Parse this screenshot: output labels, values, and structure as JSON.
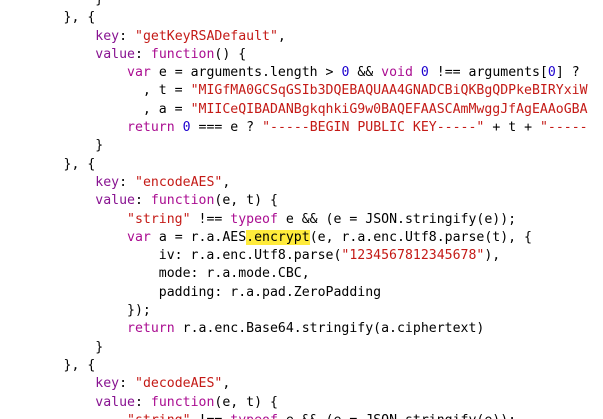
{
  "colors": {
    "background": "#ffffff",
    "text": "#000000",
    "property_key": "#881391",
    "string": "#c41a16",
    "keyword": "#aa0d91",
    "number": "#1c00cf",
    "highlight": "#ffeb3b"
  },
  "code": {
    "lines": [
      {
        "indent": "            ",
        "tokens": [
          {
            "t": "}",
            "k": "plain"
          }
        ]
      },
      {
        "indent": "        ",
        "tokens": [
          {
            "t": "}, {",
            "k": "plain"
          }
        ]
      },
      {
        "indent": "            ",
        "tokens": [
          {
            "t": "key",
            "k": "key"
          },
          {
            "t": ": ",
            "k": "plain"
          },
          {
            "t": "\"getKeyRSADefault\"",
            "k": "str"
          },
          {
            "t": ",",
            "k": "plain"
          }
        ]
      },
      {
        "indent": "            ",
        "tokens": [
          {
            "t": "value",
            "k": "key"
          },
          {
            "t": ": ",
            "k": "plain"
          },
          {
            "t": "function",
            "k": "kw"
          },
          {
            "t": "() {",
            "k": "plain"
          }
        ]
      },
      {
        "indent": "                ",
        "tokens": [
          {
            "t": "var",
            "k": "kw"
          },
          {
            "t": " e = arguments.length > ",
            "k": "plain"
          },
          {
            "t": "0",
            "k": "num"
          },
          {
            "t": " && ",
            "k": "plain"
          },
          {
            "t": "void",
            "k": "kw"
          },
          {
            "t": " ",
            "k": "plain"
          },
          {
            "t": "0",
            "k": "num"
          },
          {
            "t": " !== arguments[",
            "k": "plain"
          },
          {
            "t": "0",
            "k": "num"
          },
          {
            "t": "] ?",
            "k": "plain"
          }
        ]
      },
      {
        "indent": "                  ",
        "tokens": [
          {
            "t": ", t = ",
            "k": "plain"
          },
          {
            "t": "\"MIGfMA0GCSqGSIb3DQEBAQUAA4GNADCBiQKBgQDPkeBIRYxiW",
            "k": "str"
          }
        ]
      },
      {
        "indent": "                  ",
        "tokens": [
          {
            "t": ", a = ",
            "k": "plain"
          },
          {
            "t": "\"MIICeQIBADANBgkqhkiG9w0BAQEFAASCAmMwggJfAgEAAoGBA",
            "k": "str"
          }
        ]
      },
      {
        "indent": "                ",
        "tokens": [
          {
            "t": "return",
            "k": "kw"
          },
          {
            "t": " ",
            "k": "plain"
          },
          {
            "t": "0",
            "k": "num"
          },
          {
            "t": " === e ? ",
            "k": "plain"
          },
          {
            "t": "\"-----BEGIN PUBLIC KEY-----\"",
            "k": "str"
          },
          {
            "t": " + t + ",
            "k": "plain"
          },
          {
            "t": "\"-----",
            "k": "str"
          }
        ]
      },
      {
        "indent": "            ",
        "tokens": [
          {
            "t": "}",
            "k": "plain"
          }
        ]
      },
      {
        "indent": "        ",
        "tokens": [
          {
            "t": "}, {",
            "k": "plain"
          }
        ]
      },
      {
        "indent": "            ",
        "tokens": [
          {
            "t": "key",
            "k": "key"
          },
          {
            "t": ": ",
            "k": "plain"
          },
          {
            "t": "\"encodeAES\"",
            "k": "str"
          },
          {
            "t": ",",
            "k": "plain"
          }
        ]
      },
      {
        "indent": "            ",
        "tokens": [
          {
            "t": "value",
            "k": "key"
          },
          {
            "t": ": ",
            "k": "plain"
          },
          {
            "t": "function",
            "k": "kw"
          },
          {
            "t": "(e, t) {",
            "k": "plain"
          }
        ]
      },
      {
        "indent": "                ",
        "tokens": [
          {
            "t": "\"string\"",
            "k": "str"
          },
          {
            "t": " !== ",
            "k": "plain"
          },
          {
            "t": "typeof",
            "k": "kw"
          },
          {
            "t": " e && (e = JSON.stringify(e));",
            "k": "plain"
          }
        ]
      },
      {
        "indent": "                ",
        "tokens": [
          {
            "t": "var",
            "k": "kw"
          },
          {
            "t": " a = r.a.AES",
            "k": "plain"
          },
          {
            "t": ".encrypt",
            "k": "hl"
          },
          {
            "t": "(e, r.a.enc.Utf8.parse(t), {",
            "k": "plain"
          }
        ]
      },
      {
        "indent": "                    ",
        "tokens": [
          {
            "t": "iv: r.a.enc.Utf8.parse(",
            "k": "plain"
          },
          {
            "t": "\"1234567812345678\"",
            "k": "str"
          },
          {
            "t": "),",
            "k": "plain"
          }
        ]
      },
      {
        "indent": "                    ",
        "tokens": [
          {
            "t": "mode: r.a.mode.CBC,",
            "k": "plain"
          }
        ]
      },
      {
        "indent": "                    ",
        "tokens": [
          {
            "t": "padding: r.a.pad.ZeroPadding",
            "k": "plain"
          }
        ]
      },
      {
        "indent": "                ",
        "tokens": [
          {
            "t": "});",
            "k": "plain"
          }
        ]
      },
      {
        "indent": "                ",
        "tokens": [
          {
            "t": "return",
            "k": "kw"
          },
          {
            "t": " r.a.enc.Base64.stringify(a.ciphertext)",
            "k": "plain"
          }
        ]
      },
      {
        "indent": "            ",
        "tokens": [
          {
            "t": "}",
            "k": "plain"
          }
        ]
      },
      {
        "indent": "        ",
        "tokens": [
          {
            "t": "}, {",
            "k": "plain"
          }
        ]
      },
      {
        "indent": "            ",
        "tokens": [
          {
            "t": "key",
            "k": "key"
          },
          {
            "t": ": ",
            "k": "plain"
          },
          {
            "t": "\"decodeAES\"",
            "k": "str"
          },
          {
            "t": ",",
            "k": "plain"
          }
        ]
      },
      {
        "indent": "            ",
        "tokens": [
          {
            "t": "value",
            "k": "key"
          },
          {
            "t": ": ",
            "k": "plain"
          },
          {
            "t": "function",
            "k": "kw"
          },
          {
            "t": "(e, t) {",
            "k": "plain"
          }
        ]
      },
      {
        "indent": "                ",
        "tokens": [
          {
            "t": "\"string\"",
            "k": "str"
          },
          {
            "t": " !== ",
            "k": "plain"
          },
          {
            "t": "typeof",
            "k": "kw"
          },
          {
            "t": " e && (e = JSON.stringify(e));",
            "k": "plain"
          }
        ]
      }
    ]
  }
}
